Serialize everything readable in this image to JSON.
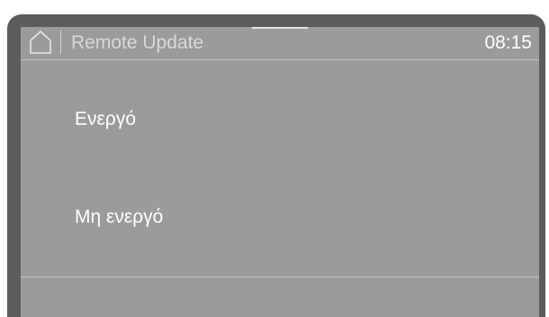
{
  "header": {
    "home_icon": "home-icon",
    "title": "Remote Update",
    "time": "08:15"
  },
  "options": [
    {
      "label": "Ενεργό"
    },
    {
      "label": "Μη ενεργό"
    }
  ],
  "colors": {
    "bezel": "#5b5c5e",
    "screen_background": "#9a9b9d",
    "title_text": "#d7d8d9",
    "primary_text": "#ffffff",
    "divider": "#c4c5c7"
  }
}
